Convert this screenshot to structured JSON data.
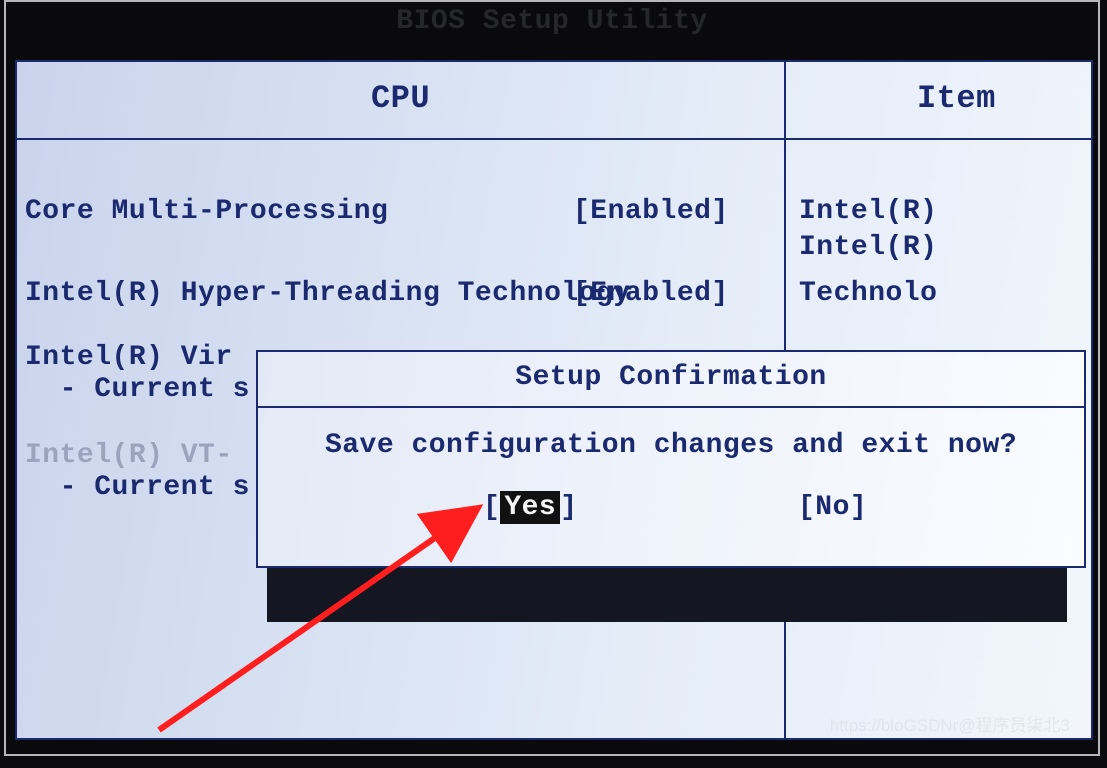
{
  "utility_title": "BIOS Setup Utility",
  "header": {
    "left": "CPU",
    "right": "Item "
  },
  "rows": {
    "r1": {
      "label": "Core Multi-Processing",
      "value": "[Enabled]"
    },
    "r2": {
      "label": "Intel(R) Hyper-Threading Technology",
      "value": "[Enabled]"
    },
    "r3": {
      "label": "Intel(R) Vir",
      "sub": "  - Current s"
    },
    "r4": {
      "label": "Intel(R) VT-",
      "sub": "  - Current s"
    }
  },
  "side": {
    "s1": "Intel(R)",
    "s2": "Intel(R)",
    "s3": "Technolo"
  },
  "dialog": {
    "title": "Setup Confirmation",
    "message": "Save configuration changes and exit now?",
    "yes_open": "[",
    "yes_text": "Yes",
    "yes_close": "]",
    "no": "[No]"
  },
  "watermark": "https://bloGSDNr@程序员柒北3"
}
